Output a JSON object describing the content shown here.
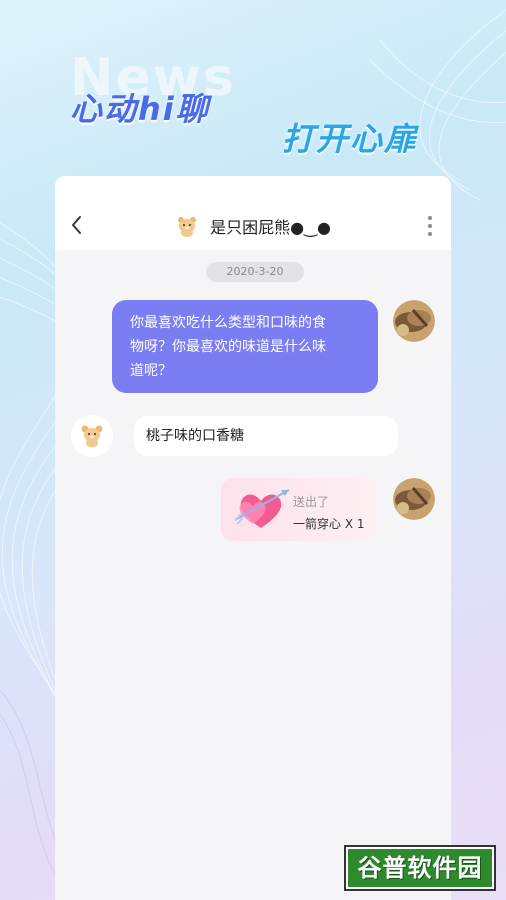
{
  "banner": {
    "bg_word": "News",
    "slogan_left": "心动hi聊",
    "slogan_right": "打开心扉"
  },
  "chat": {
    "header": {
      "back_icon": "chevron-left-icon",
      "contact_name": "是只困屁熊●‿●",
      "contact_avatar": "bear-avatar",
      "more_icon": "more-vertical-icon"
    },
    "date_label": "2020-3-20",
    "messages": [
      {
        "from": "me",
        "text_line1": "你最喜欢吃什么类型和口味的食",
        "text_line2": "物呀？你最喜欢的味道是什么味",
        "text_line3": "道呢？"
      },
      {
        "from": "other",
        "text": "桃子味的口香糖"
      },
      {
        "from": "me",
        "type": "gift",
        "status": "送出了",
        "gift_name": "一箭穿心 X 1",
        "gift_icon": "heart-arrow-icon"
      }
    ],
    "colors": {
      "my_bubble": "#7b7ef2",
      "other_bubble": "#ffffff",
      "chat_bg": "#f5f5f7"
    }
  },
  "watermark": {
    "text": "谷普软件园"
  }
}
